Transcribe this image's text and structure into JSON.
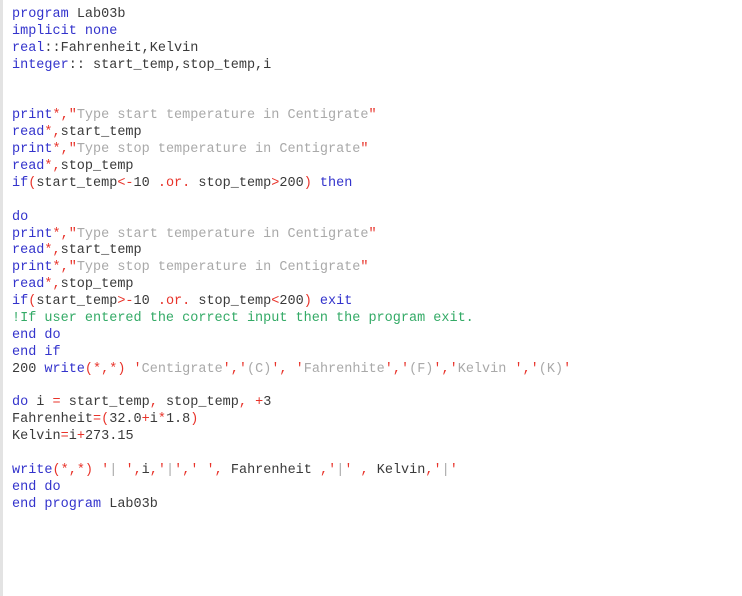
{
  "editor": {
    "language": "Fortran",
    "program_name": "Lab03b",
    "background_color": "#ffffff",
    "left_border_color": "#e3e3e3",
    "colors": {
      "keyword": "#3333cc",
      "operator": "#e8332a",
      "string": "#a9a9a9",
      "comment": "#33aa66",
      "identifier": "#3a3a3a"
    }
  },
  "lines": [
    {
      "n": 1,
      "text": "program Lab03b",
      "tokens": [
        {
          "t": "program",
          "c": "kw"
        },
        {
          "t": " Lab03b",
          "c": "id"
        }
      ]
    },
    {
      "n": 2,
      "text": "implicit none",
      "tokens": [
        {
          "t": "implicit none",
          "c": "kw"
        }
      ]
    },
    {
      "n": 3,
      "text": "real::Fahrenheit,Kelvin",
      "tokens": [
        {
          "t": "real",
          "c": "kw"
        },
        {
          "t": "::",
          "c": "id"
        },
        {
          "t": "Fahrenheit",
          "c": "id"
        },
        {
          "t": ",",
          "c": "id"
        },
        {
          "t": "Kelvin",
          "c": "id"
        }
      ]
    },
    {
      "n": 4,
      "text": "integer:: start_temp,stop_temp,i",
      "tokens": [
        {
          "t": "integer",
          "c": "kw"
        },
        {
          "t": ":: start_temp,stop_temp,i",
          "c": "id"
        }
      ]
    },
    {
      "n": 5,
      "text": "",
      "tokens": []
    },
    {
      "n": 6,
      "text": "",
      "tokens": []
    },
    {
      "n": 7,
      "text": "print*,\"Type start temperature in Centigrate\"",
      "tokens": [
        {
          "t": "print",
          "c": "kw"
        },
        {
          "t": "*,",
          "c": "op"
        },
        {
          "t": "\"",
          "c": "op"
        },
        {
          "t": "Type start temperature in Centigrate",
          "c": "str"
        },
        {
          "t": "\"",
          "c": "op"
        }
      ]
    },
    {
      "n": 8,
      "text": "read*,start_temp",
      "tokens": [
        {
          "t": "read",
          "c": "kw"
        },
        {
          "t": "*,",
          "c": "op"
        },
        {
          "t": "start_temp",
          "c": "id"
        }
      ]
    },
    {
      "n": 9,
      "text": "print*,\"Type stop temperature in Centigrate\"",
      "tokens": [
        {
          "t": "print",
          "c": "kw"
        },
        {
          "t": "*,",
          "c": "op"
        },
        {
          "t": "\"",
          "c": "op"
        },
        {
          "t": "Type stop temperature in Centigrate",
          "c": "str"
        },
        {
          "t": "\"",
          "c": "op"
        }
      ]
    },
    {
      "n": 10,
      "text": "read*,stop_temp",
      "tokens": [
        {
          "t": "read",
          "c": "kw"
        },
        {
          "t": "*,",
          "c": "op"
        },
        {
          "t": "stop_temp",
          "c": "id"
        }
      ]
    },
    {
      "n": 11,
      "text": "if(start_temp<-10 .or. stop_temp>200) then",
      "tokens": [
        {
          "t": "if",
          "c": "kw"
        },
        {
          "t": "(",
          "c": "op"
        },
        {
          "t": "start_temp",
          "c": "id"
        },
        {
          "t": "<-",
          "c": "op"
        },
        {
          "t": "10 ",
          "c": "id"
        },
        {
          "t": ".or.",
          "c": "op"
        },
        {
          "t": " stop_temp",
          "c": "id"
        },
        {
          "t": ">",
          "c": "op"
        },
        {
          "t": "200",
          "c": "id"
        },
        {
          "t": ")",
          "c": "op"
        },
        {
          "t": " ",
          "c": "id"
        },
        {
          "t": "then",
          "c": "kw"
        }
      ]
    },
    {
      "n": 12,
      "text": "",
      "tokens": []
    },
    {
      "n": 13,
      "text": "do",
      "tokens": [
        {
          "t": "do",
          "c": "kw"
        }
      ]
    },
    {
      "n": 14,
      "text": "print*,\"Type start temperature in Centigrate\"",
      "tokens": [
        {
          "t": "print",
          "c": "kw"
        },
        {
          "t": "*,",
          "c": "op"
        },
        {
          "t": "\"",
          "c": "op"
        },
        {
          "t": "Type start temperature in Centigrate",
          "c": "str"
        },
        {
          "t": "\"",
          "c": "op"
        }
      ]
    },
    {
      "n": 15,
      "text": "read*,start_temp",
      "tokens": [
        {
          "t": "read",
          "c": "kw"
        },
        {
          "t": "*,",
          "c": "op"
        },
        {
          "t": "start_temp",
          "c": "id"
        }
      ]
    },
    {
      "n": 16,
      "text": "print*,\"Type stop temperature in Centigrate\"",
      "tokens": [
        {
          "t": "print",
          "c": "kw"
        },
        {
          "t": "*,",
          "c": "op"
        },
        {
          "t": "\"",
          "c": "op"
        },
        {
          "t": "Type stop temperature in Centigrate",
          "c": "str"
        },
        {
          "t": "\"",
          "c": "op"
        }
      ]
    },
    {
      "n": 17,
      "text": "read*,stop_temp",
      "tokens": [
        {
          "t": "read",
          "c": "kw"
        },
        {
          "t": "*,",
          "c": "op"
        },
        {
          "t": "stop_temp",
          "c": "id"
        }
      ]
    },
    {
      "n": 18,
      "text": "if(start_temp>-10 .or. stop_temp<200) exit",
      "tokens": [
        {
          "t": "if",
          "c": "kw"
        },
        {
          "t": "(",
          "c": "op"
        },
        {
          "t": "start_temp",
          "c": "id"
        },
        {
          "t": ">-",
          "c": "op"
        },
        {
          "t": "10 ",
          "c": "id"
        },
        {
          "t": ".or.",
          "c": "op"
        },
        {
          "t": " stop_temp",
          "c": "id"
        },
        {
          "t": "<",
          "c": "op"
        },
        {
          "t": "200",
          "c": "id"
        },
        {
          "t": ")",
          "c": "op"
        },
        {
          "t": " ",
          "c": "id"
        },
        {
          "t": "exit",
          "c": "kw"
        }
      ]
    },
    {
      "n": 19,
      "text": "!If user entered the correct input then the program exit.",
      "tokens": [
        {
          "t": "!If user entered the correct input then the program exit.",
          "c": "cmt"
        }
      ]
    },
    {
      "n": 20,
      "text": "end do",
      "tokens": [
        {
          "t": "end do",
          "c": "kw"
        }
      ]
    },
    {
      "n": 21,
      "text": "end if",
      "tokens": [
        {
          "t": "end if",
          "c": "kw"
        }
      ]
    },
    {
      "n": 22,
      "text": "200 write(*,*) 'Centigrate','(C)', 'Fahrenhite','(F)','Kelvin ','(K)'",
      "tokens": [
        {
          "t": "200 ",
          "c": "num"
        },
        {
          "t": "write",
          "c": "kw"
        },
        {
          "t": "(*,*)",
          "c": "op"
        },
        {
          "t": " ",
          "c": "id"
        },
        {
          "t": "'",
          "c": "op"
        },
        {
          "t": "Centigrate",
          "c": "str"
        },
        {
          "t": "'",
          "c": "op"
        },
        {
          "t": ",",
          "c": "op"
        },
        {
          "t": "'",
          "c": "op"
        },
        {
          "t": "(C)",
          "c": "str"
        },
        {
          "t": "'",
          "c": "op"
        },
        {
          "t": ",",
          "c": "op"
        },
        {
          "t": " ",
          "c": "id"
        },
        {
          "t": "'",
          "c": "op"
        },
        {
          "t": "Fahrenhite",
          "c": "str"
        },
        {
          "t": "'",
          "c": "op"
        },
        {
          "t": ",",
          "c": "op"
        },
        {
          "t": "'",
          "c": "op"
        },
        {
          "t": "(F)",
          "c": "str"
        },
        {
          "t": "'",
          "c": "op"
        },
        {
          "t": ",",
          "c": "op"
        },
        {
          "t": "'",
          "c": "op"
        },
        {
          "t": "Kelvin ",
          "c": "str"
        },
        {
          "t": "'",
          "c": "op"
        },
        {
          "t": ",",
          "c": "op"
        },
        {
          "t": "'",
          "c": "op"
        },
        {
          "t": "(K)",
          "c": "str"
        },
        {
          "t": "'",
          "c": "op"
        }
      ]
    },
    {
      "n": 23,
      "text": "",
      "tokens": []
    },
    {
      "n": 24,
      "text": "do i = start_temp, stop_temp, +3",
      "tokens": [
        {
          "t": "do",
          "c": "kw"
        },
        {
          "t": " i ",
          "c": "id"
        },
        {
          "t": "=",
          "c": "op"
        },
        {
          "t": " start_temp",
          "c": "id"
        },
        {
          "t": ",",
          "c": "op"
        },
        {
          "t": " stop_temp",
          "c": "id"
        },
        {
          "t": ",",
          "c": "op"
        },
        {
          "t": " ",
          "c": "id"
        },
        {
          "t": "+",
          "c": "op"
        },
        {
          "t": "3",
          "c": "id"
        }
      ]
    },
    {
      "n": 25,
      "text": "Fahrenheit=(32.0+i*1.8)",
      "tokens": [
        {
          "t": "Fahrenheit",
          "c": "id"
        },
        {
          "t": "=(",
          "c": "op"
        },
        {
          "t": "32.0",
          "c": "id"
        },
        {
          "t": "+",
          "c": "op"
        },
        {
          "t": "i",
          "c": "id"
        },
        {
          "t": "*",
          "c": "op"
        },
        {
          "t": "1.8",
          "c": "id"
        },
        {
          "t": ")",
          "c": "op"
        }
      ]
    },
    {
      "n": 26,
      "text": "Kelvin=i+273.15",
      "tokens": [
        {
          "t": "Kelvin",
          "c": "id"
        },
        {
          "t": "=",
          "c": "op"
        },
        {
          "t": "i",
          "c": "id"
        },
        {
          "t": "+",
          "c": "op"
        },
        {
          "t": "273.15",
          "c": "id"
        }
      ]
    },
    {
      "n": 27,
      "text": "",
      "tokens": []
    },
    {
      "n": 28,
      "text": "write(*,*) '| ',i,'|',' ', Fahrenheit ,'|' , Kelvin,'|'",
      "tokens": [
        {
          "t": "write",
          "c": "kw"
        },
        {
          "t": "(*,*)",
          "c": "op"
        },
        {
          "t": " ",
          "c": "id"
        },
        {
          "t": "'",
          "c": "op"
        },
        {
          "t": "| ",
          "c": "str"
        },
        {
          "t": "'",
          "c": "op"
        },
        {
          "t": ",",
          "c": "op"
        },
        {
          "t": "i",
          "c": "id"
        },
        {
          "t": ",",
          "c": "op"
        },
        {
          "t": "'",
          "c": "op"
        },
        {
          "t": "|",
          "c": "str"
        },
        {
          "t": "'",
          "c": "op"
        },
        {
          "t": ",",
          "c": "op"
        },
        {
          "t": "'",
          "c": "op"
        },
        {
          "t": " ",
          "c": "str"
        },
        {
          "t": "'",
          "c": "op"
        },
        {
          "t": ",",
          "c": "op"
        },
        {
          "t": " Fahrenheit ",
          "c": "id"
        },
        {
          "t": ",",
          "c": "op"
        },
        {
          "t": "'",
          "c": "op"
        },
        {
          "t": "|",
          "c": "str"
        },
        {
          "t": "'",
          "c": "op"
        },
        {
          "t": " ",
          "c": "id"
        },
        {
          "t": ",",
          "c": "op"
        },
        {
          "t": " Kelvin",
          "c": "id"
        },
        {
          "t": ",",
          "c": "op"
        },
        {
          "t": "'",
          "c": "op"
        },
        {
          "t": "|",
          "c": "str"
        },
        {
          "t": "'",
          "c": "op"
        }
      ]
    },
    {
      "n": 29,
      "text": "end do",
      "tokens": [
        {
          "t": "end do",
          "c": "kw"
        }
      ]
    },
    {
      "n": 30,
      "text": "end program Lab03b",
      "tokens": [
        {
          "t": "end program",
          "c": "kw"
        },
        {
          "t": " Lab03b",
          "c": "id"
        }
      ]
    }
  ]
}
